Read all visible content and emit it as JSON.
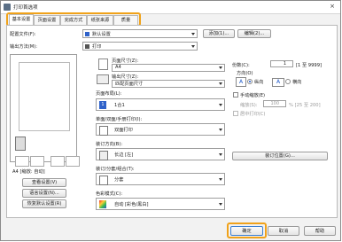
{
  "window": {
    "title": "打印首选项"
  },
  "tabs": [
    {
      "label": "基本设置"
    },
    {
      "label": "页面设置"
    },
    {
      "label": "完成方式"
    },
    {
      "label": "纸张来源"
    },
    {
      "label": "质量"
    }
  ],
  "profile": {
    "label": "配置文件(F):",
    "value": "默认设置",
    "add_label": "添加(1)...",
    "edit_label": "编辑(2)..."
  },
  "output": {
    "label": "输出方法(M):",
    "value": "打印"
  },
  "preview": {
    "caption": "A4 [缩放: 自动]",
    "view_settings_label": "查看设置(V)",
    "language_settings_label": "语言设置(N)...",
    "restore_defaults_label": "恢复默认设置(R)"
  },
  "page_size": {
    "label": "页面尺寸(Z):",
    "value": "A4"
  },
  "output_size": {
    "label": "输出尺寸(Z):",
    "value": "匹配页面尺寸"
  },
  "copies": {
    "label": "份数(C):",
    "value": "1",
    "range": "[1 至 9999]"
  },
  "orientation": {
    "label": "方向(O)",
    "portrait": "纵向",
    "landscape": "横向",
    "portrait_glyph": "A",
    "landscape_glyph": "A"
  },
  "page_layout": {
    "label": "页面布局(L):",
    "value": "1合1"
  },
  "manual_scaling": {
    "label": "手动缩放(E)",
    "scale_label": "缩放(S):",
    "scale_value": "100",
    "scale_range": "% [25 至 200]",
    "center_label": "居中打印(C)"
  },
  "duplex": {
    "label": "单面/双面/手册打印(I):",
    "value": "双面打印"
  },
  "binding": {
    "label": "装订方向(B):",
    "value": "长边 [左]",
    "location_button_label": "装订位置(G)..."
  },
  "collate": {
    "label": "装订/分套/组合(T):",
    "value": "分套"
  },
  "color_mode": {
    "label": "色彩模式(C):",
    "value": "自动 [彩色/黑白]"
  },
  "footer": {
    "ok_label": "确定",
    "cancel_label": "取消",
    "help_label": "帮助"
  },
  "colors": {
    "highlight": "#f0a21a",
    "accent": "#1a56c9"
  }
}
